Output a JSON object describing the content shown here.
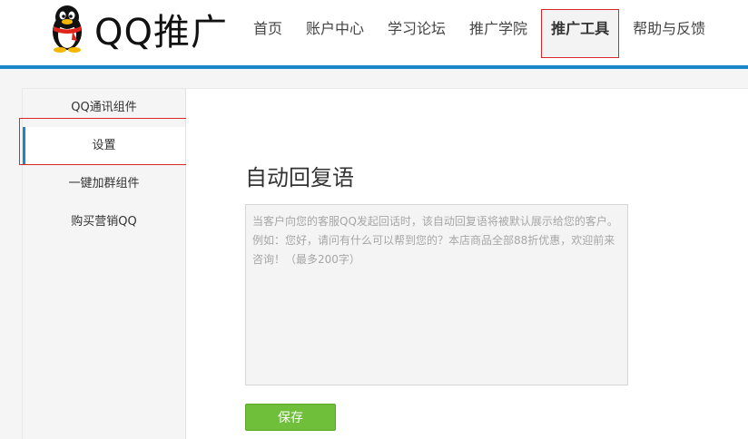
{
  "header": {
    "logo_text": "QQ推广",
    "nav": [
      {
        "label": "首页"
      },
      {
        "label": "账户中心"
      },
      {
        "label": "学习论坛"
      },
      {
        "label": "推广学院"
      },
      {
        "label": "推广工具"
      },
      {
        "label": "帮助与反馈"
      }
    ],
    "active_nav": "推广工具"
  },
  "sidebar": {
    "items": [
      {
        "label": "QQ通讯组件"
      },
      {
        "label": "设置"
      },
      {
        "label": "一键加群组件"
      },
      {
        "label": "购买营销QQ"
      }
    ],
    "active_item": "设置"
  },
  "main": {
    "title": "自动回复语",
    "reply_placeholder": "当客户向您的客服QQ发起回话时，该自动回复语将被默认展示给您的客户。例如：您好，请问有什么可以帮到您的？本店商品全部88折优惠，欢迎前来咨询！（最多200字）",
    "reply_value": "",
    "save_label": "保存"
  },
  "colors": {
    "accent_blue": "#1a87c9",
    "save_green": "#6fbf3a",
    "highlight_red": "#d9262b"
  }
}
